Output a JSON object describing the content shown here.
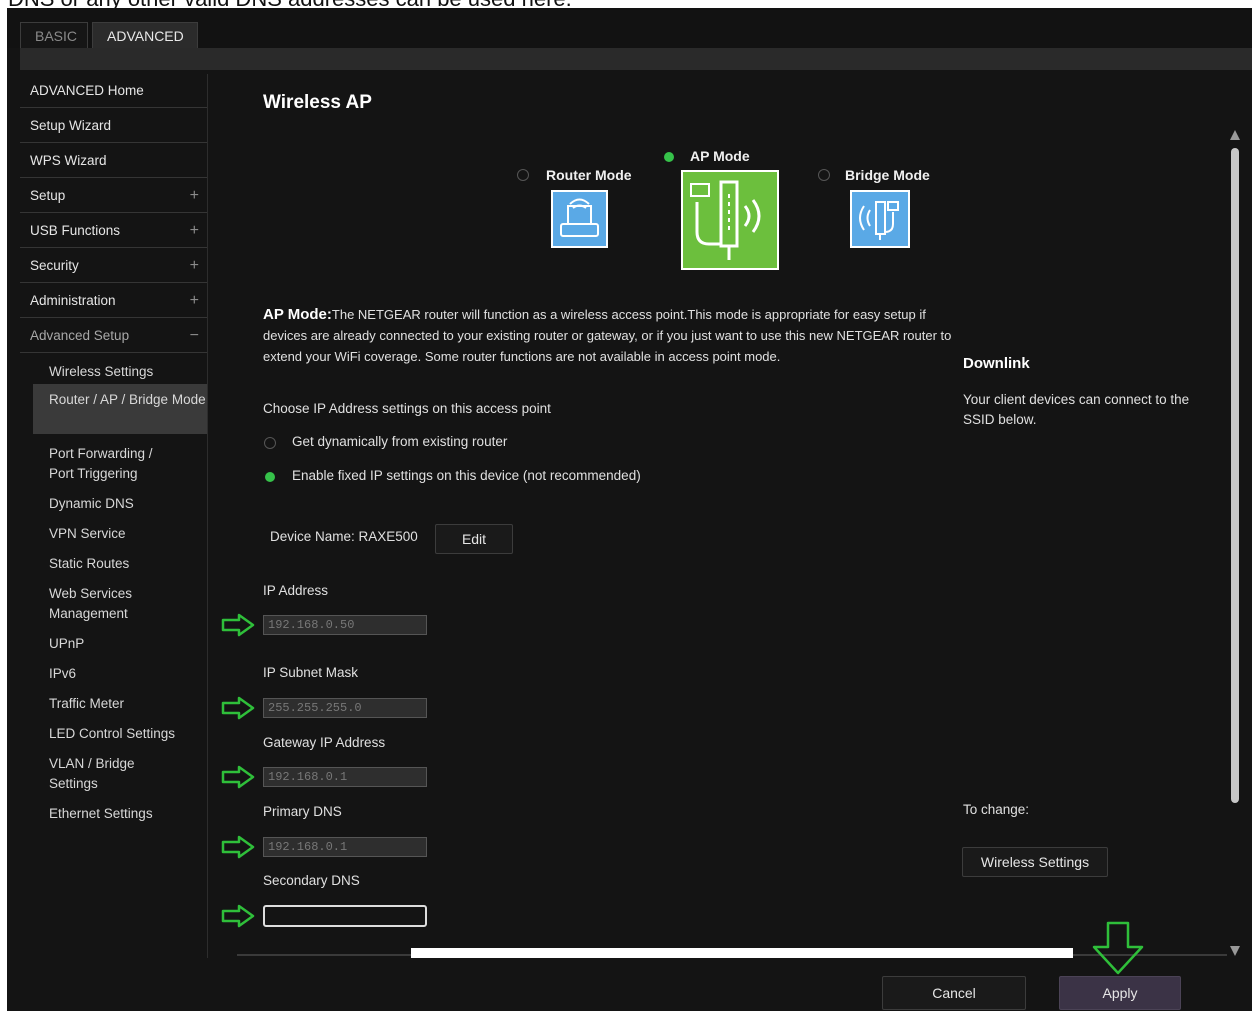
{
  "caption": "DNS or any other valid DNS addresses can be used here.",
  "tabs": {
    "basic": "BASIC",
    "advanced": "ADVANCED"
  },
  "sidebar": {
    "items": [
      {
        "label": "ADVANCED Home",
        "toggle": ""
      },
      {
        "label": "Setup Wizard",
        "toggle": ""
      },
      {
        "label": "WPS Wizard",
        "toggle": ""
      },
      {
        "label": "Setup",
        "toggle": "+"
      },
      {
        "label": "USB Functions",
        "toggle": "+"
      },
      {
        "label": "Security",
        "toggle": "+"
      },
      {
        "label": "Administration",
        "toggle": "+"
      },
      {
        "label": "Advanced Setup",
        "toggle": "−"
      }
    ],
    "subitems": [
      "Wireless Settings",
      "Router / AP / Bridge Mode",
      "Port Forwarding / Port Triggering",
      "Dynamic DNS",
      "VPN Service",
      "Static Routes",
      "Web Services Management",
      "UPnP",
      "IPv6",
      "Traffic Meter",
      "LED Control Settings",
      "VLAN / Bridge Settings",
      "Ethernet Settings"
    ]
  },
  "main": {
    "title": "Wireless AP",
    "modes": {
      "router": "Router Mode",
      "ap": "AP Mode",
      "bridge": "Bridge Mode"
    },
    "desc_bold": "AP Mode:",
    "desc_text": "The NETGEAR router will function as a wireless access point.This mode is appropriate for easy setup if devices are already connected to your existing router or gateway, or if you just want to use this new NETGEAR router to extend your WiFi coverage. Some router functions are not available in access point mode.",
    "choose_label": "Choose IP Address settings on this access point",
    "opt_dynamic": "Get dynamically from existing router",
    "opt_fixed": "Enable fixed IP settings on this device (not recommended)",
    "device_name": "Device Name: RAXE500",
    "edit_label": "Edit",
    "ip_label": "IP Address",
    "ip_value": "192.168.0.50",
    "mask_label": "IP Subnet Mask",
    "mask_value": "255.255.255.0",
    "gw_label": "Gateway IP Address",
    "gw_value": "192.168.0.1",
    "dns1_label": "Primary DNS",
    "dns1_value": "192.168.0.1",
    "dns2_label": "Secondary DNS",
    "dns2_value": ""
  },
  "right": {
    "downlink_title": "Downlink",
    "downlink_text": "Your client devices can connect to the SSID below.",
    "to_change": "To change:",
    "wireless_btn": "Wireless Settings"
  },
  "footer": {
    "cancel": "Cancel",
    "apply": "Apply"
  },
  "colors": {
    "accent_green": "#36c24a",
    "annotation_green": "#2fbf3a",
    "apply_bg": "#3b3346"
  }
}
